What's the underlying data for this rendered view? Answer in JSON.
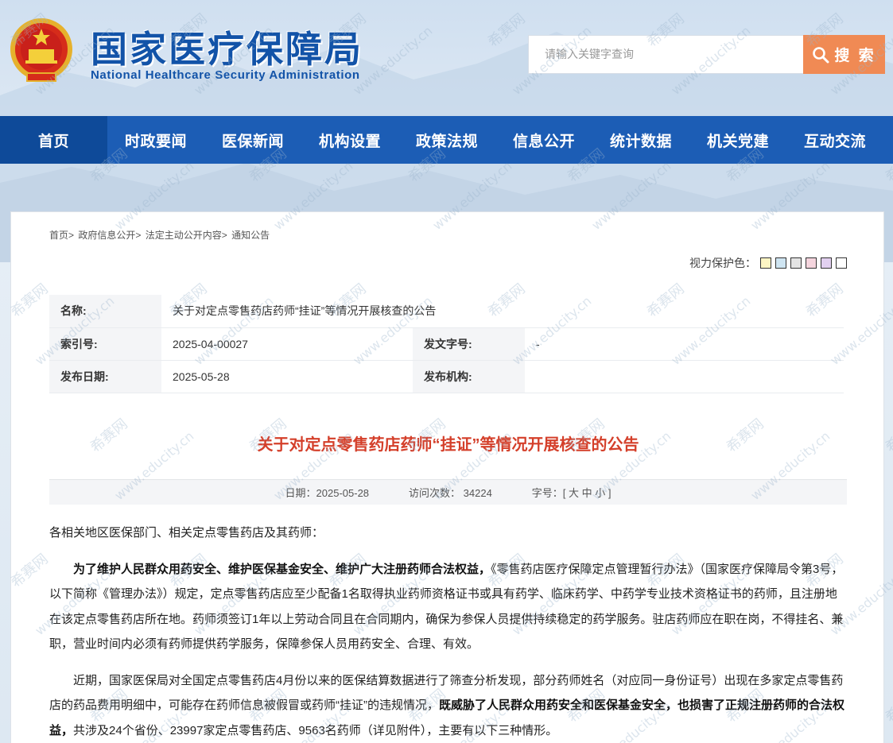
{
  "header": {
    "title_cn": "国家医疗保障局",
    "title_en": "National Healthcare Security Administration",
    "search_placeholder": "请输入关键字查询",
    "search_button": "搜 索"
  },
  "nav": {
    "items": [
      "首页",
      "时政要闻",
      "医保新闻",
      "机构设置",
      "政策法规",
      "信息公开",
      "统计数据",
      "机关党建",
      "互动交流"
    ],
    "active": "首页"
  },
  "breadcrumb": [
    "首页>",
    "政府信息公开>",
    "法定主动公开内容>",
    "通知公告"
  ],
  "vision": {
    "label": "视力保护色：",
    "swatches": [
      "#fdf5c4",
      "#cfe5f2",
      "#e3e3e3",
      "#f5d5de",
      "#e2d0f0",
      "#ffffff"
    ]
  },
  "meta": {
    "name_label": "名称:",
    "name_value": "关于对定点零售药店药师“挂证”等情况开展核查的公告",
    "index_label": "索引号:",
    "index_value": "2025-04-00027",
    "docno_label": "发文字号:",
    "docno_value": "-",
    "date_label": "发布日期:",
    "date_value": "2025-05-28",
    "org_label": "发布机构:",
    "org_value": ""
  },
  "doc": {
    "title": "关于对定点零售药店药师“挂证”等情况开展核查的公告",
    "date": "日期：2025-05-28",
    "visits": "访问次数：  34224",
    "fontsize": "字号：[ 大 中 小 ]",
    "salutation": "各相关地区医保部门、相关定点零售药店及其药师：",
    "p1_bold": "为了维护人民群众用药安全、维护医保基金安全、维护广大注册药师合法权益，",
    "p1_rest": "《零售药店医疗保障定点管理暂行办法》（国家医疗保障局令第3号，以下简称《管理办法》）规定，定点零售药店应至少配备1名取得执业药师资格证书或具有药学、临床药学、中药学专业技术资格证书的药师，且注册地在该定点零售药店所在地。药师须签订1年以上劳动合同且在合同期内，确保为参保人员提供持续稳定的药学服务。驻店药师应在职在岗，不得挂名、兼职，营业时间内必须有药师提供药学服务，保障参保人员用药安全、合理、有效。",
    "p2_start": "近期，国家医保局对全国定点零售药店4月份以来的医保结算数据进行了筛查分析发现，部分药师姓名（对应同一身份证号）出现在多家定点零售药店的药品费用明细中，可能存在药师信息被假冒或药师“挂证”的违规情况，",
    "p2_bold": "既威胁了人民群众用药安全和医保基金安全，也损害了正规注册药师的合法权益，",
    "p2_end": "共涉及24个省份、23997家定点零售药店、9563名药师（详见附件），主要有以下三种情形。"
  },
  "watermark_text": [
    "希赛网",
    "www.educity.cn"
  ]
}
